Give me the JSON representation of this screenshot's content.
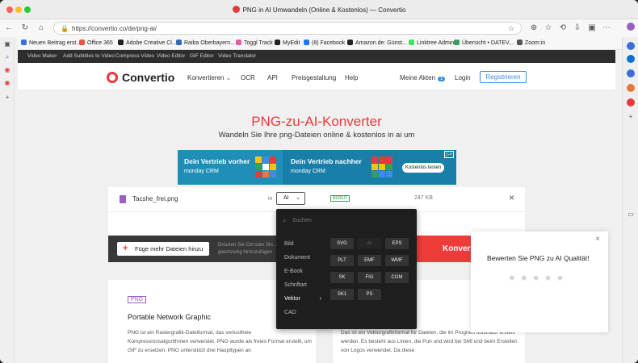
{
  "window": {
    "title": "PNG in AI Umwandeln (Online & Kostenlos) — Convertio"
  },
  "toolbar": {
    "url": "https://convertio.co/de/png-ai/"
  },
  "bookmarks": [
    {
      "label": "Neuen Beitrag erst...",
      "color": "#3b6fd6"
    },
    {
      "label": "Office 365",
      "color": "#e8563b"
    },
    {
      "label": "Adobe Creative Cl...",
      "color": "#222222"
    },
    {
      "label": "Raiba Oberbayern...",
      "color": "#2d6db5"
    },
    {
      "label": "Toggl Track",
      "color": "#e05daa"
    },
    {
      "label": "MyEdit",
      "color": "#222222"
    },
    {
      "label": "(8) Facebook",
      "color": "#1877f2"
    },
    {
      "label": "Amazon.de: Günst...",
      "color": "#222222"
    },
    {
      "label": "Linktree Admin",
      "color": "#43e55e"
    },
    {
      "label": "Übersicht • DATEV...",
      "color": "#3a9e5b"
    },
    {
      "label": "Zoom:in",
      "color": "#555555"
    }
  ],
  "topnav": [
    "Video Maker",
    "Add Subtitles to Video",
    "Compress Video",
    "Video Editor",
    "GIF Editor",
    "Video Translator"
  ],
  "header": {
    "logo": "Convertio",
    "nav": {
      "convert": "Konvertieren",
      "ocr": "OCR",
      "api": "API",
      "pricing": "Preisgestaltung",
      "help": "Help"
    },
    "my_files": "Meine Akten",
    "files_count": "1",
    "login": "Login",
    "register": "Registrieren"
  },
  "hero": {
    "title": "PNG-zu-AI-Konverter",
    "subtitle": "Wandeln Sie Ihre png-Dateien online & kostenlos in ai um"
  },
  "ad": {
    "left_title": "Dein Vertrieb vorher",
    "left_brand": "monday CRM",
    "right_title": "Dein Vertrieb nachher",
    "right_brand": "monday CRM",
    "cta": "Kostenlos testen"
  },
  "file": {
    "name": "Tacshe_frei.png",
    "in_label": "in",
    "format": "AI",
    "status": "BEREIT",
    "size": "247 KB"
  },
  "actions": {
    "add_more": "Füge mehr Dateien hinzu",
    "hint": "Drücken Sie Ctrl oder Shi... gleichzeitig hinzuzufügen",
    "convert": "Konvertieren"
  },
  "dropdown": {
    "search_placeholder": "Suchen",
    "categories": [
      "Bild",
      "Dokument",
      "E-Book",
      "Schriftart",
      "Vektor",
      "CAD"
    ],
    "active_category": "Vektor",
    "formats": [
      "SVG",
      "AI",
      "EPS",
      "PLT",
      "EMF",
      "WMF",
      "SK",
      "FIG",
      "CGM",
      "SK1",
      "PS"
    ],
    "disabled_format": "AI"
  },
  "info": {
    "tag": "PNG",
    "title": "Portable Network Graphic",
    "text": "PNG ist ein Rastergrafik-Dateiformat, das verlustfreie Kompressionsalgorithmen verwendet. PNG wurde als freies Format erstellt, um GIF zu ersetzen. PNG unterstützt drei Haupttypen an",
    "text2": "Das ist ein Vektorgrafikformat für Dateien, die im Program Illustrator erstellt werden. Es besteht aus Linien, die Pun und wird bei SMI und beim Erstellen von Logos verwendet. Da diese"
  },
  "rating": {
    "text": "Bewerten Sie PNG zu AI Qualität!",
    "stars": "★★★★★"
  }
}
